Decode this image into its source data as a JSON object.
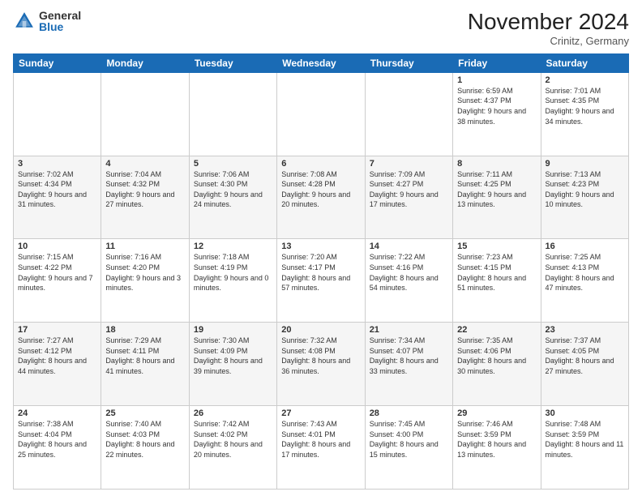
{
  "logo": {
    "general": "General",
    "blue": "Blue"
  },
  "header": {
    "month": "November 2024",
    "location": "Crinitz, Germany"
  },
  "weekdays": [
    "Sunday",
    "Monday",
    "Tuesday",
    "Wednesday",
    "Thursday",
    "Friday",
    "Saturday"
  ],
  "weeks": [
    [
      {
        "day": "",
        "sunrise": "",
        "sunset": "",
        "daylight": ""
      },
      {
        "day": "",
        "sunrise": "",
        "sunset": "",
        "daylight": ""
      },
      {
        "day": "",
        "sunrise": "",
        "sunset": "",
        "daylight": ""
      },
      {
        "day": "",
        "sunrise": "",
        "sunset": "",
        "daylight": ""
      },
      {
        "day": "",
        "sunrise": "",
        "sunset": "",
        "daylight": ""
      },
      {
        "day": "1",
        "sunrise": "Sunrise: 6:59 AM",
        "sunset": "Sunset: 4:37 PM",
        "daylight": "Daylight: 9 hours and 38 minutes."
      },
      {
        "day": "2",
        "sunrise": "Sunrise: 7:01 AM",
        "sunset": "Sunset: 4:35 PM",
        "daylight": "Daylight: 9 hours and 34 minutes."
      }
    ],
    [
      {
        "day": "3",
        "sunrise": "Sunrise: 7:02 AM",
        "sunset": "Sunset: 4:34 PM",
        "daylight": "Daylight: 9 hours and 31 minutes."
      },
      {
        "day": "4",
        "sunrise": "Sunrise: 7:04 AM",
        "sunset": "Sunset: 4:32 PM",
        "daylight": "Daylight: 9 hours and 27 minutes."
      },
      {
        "day": "5",
        "sunrise": "Sunrise: 7:06 AM",
        "sunset": "Sunset: 4:30 PM",
        "daylight": "Daylight: 9 hours and 24 minutes."
      },
      {
        "day": "6",
        "sunrise": "Sunrise: 7:08 AM",
        "sunset": "Sunset: 4:28 PM",
        "daylight": "Daylight: 9 hours and 20 minutes."
      },
      {
        "day": "7",
        "sunrise": "Sunrise: 7:09 AM",
        "sunset": "Sunset: 4:27 PM",
        "daylight": "Daylight: 9 hours and 17 minutes."
      },
      {
        "day": "8",
        "sunrise": "Sunrise: 7:11 AM",
        "sunset": "Sunset: 4:25 PM",
        "daylight": "Daylight: 9 hours and 13 minutes."
      },
      {
        "day": "9",
        "sunrise": "Sunrise: 7:13 AM",
        "sunset": "Sunset: 4:23 PM",
        "daylight": "Daylight: 9 hours and 10 minutes."
      }
    ],
    [
      {
        "day": "10",
        "sunrise": "Sunrise: 7:15 AM",
        "sunset": "Sunset: 4:22 PM",
        "daylight": "Daylight: 9 hours and 7 minutes."
      },
      {
        "day": "11",
        "sunrise": "Sunrise: 7:16 AM",
        "sunset": "Sunset: 4:20 PM",
        "daylight": "Daylight: 9 hours and 3 minutes."
      },
      {
        "day": "12",
        "sunrise": "Sunrise: 7:18 AM",
        "sunset": "Sunset: 4:19 PM",
        "daylight": "Daylight: 9 hours and 0 minutes."
      },
      {
        "day": "13",
        "sunrise": "Sunrise: 7:20 AM",
        "sunset": "Sunset: 4:17 PM",
        "daylight": "Daylight: 8 hours and 57 minutes."
      },
      {
        "day": "14",
        "sunrise": "Sunrise: 7:22 AM",
        "sunset": "Sunset: 4:16 PM",
        "daylight": "Daylight: 8 hours and 54 minutes."
      },
      {
        "day": "15",
        "sunrise": "Sunrise: 7:23 AM",
        "sunset": "Sunset: 4:15 PM",
        "daylight": "Daylight: 8 hours and 51 minutes."
      },
      {
        "day": "16",
        "sunrise": "Sunrise: 7:25 AM",
        "sunset": "Sunset: 4:13 PM",
        "daylight": "Daylight: 8 hours and 47 minutes."
      }
    ],
    [
      {
        "day": "17",
        "sunrise": "Sunrise: 7:27 AM",
        "sunset": "Sunset: 4:12 PM",
        "daylight": "Daylight: 8 hours and 44 minutes."
      },
      {
        "day": "18",
        "sunrise": "Sunrise: 7:29 AM",
        "sunset": "Sunset: 4:11 PM",
        "daylight": "Daylight: 8 hours and 41 minutes."
      },
      {
        "day": "19",
        "sunrise": "Sunrise: 7:30 AM",
        "sunset": "Sunset: 4:09 PM",
        "daylight": "Daylight: 8 hours and 39 minutes."
      },
      {
        "day": "20",
        "sunrise": "Sunrise: 7:32 AM",
        "sunset": "Sunset: 4:08 PM",
        "daylight": "Daylight: 8 hours and 36 minutes."
      },
      {
        "day": "21",
        "sunrise": "Sunrise: 7:34 AM",
        "sunset": "Sunset: 4:07 PM",
        "daylight": "Daylight: 8 hours and 33 minutes."
      },
      {
        "day": "22",
        "sunrise": "Sunrise: 7:35 AM",
        "sunset": "Sunset: 4:06 PM",
        "daylight": "Daylight: 8 hours and 30 minutes."
      },
      {
        "day": "23",
        "sunrise": "Sunrise: 7:37 AM",
        "sunset": "Sunset: 4:05 PM",
        "daylight": "Daylight: 8 hours and 27 minutes."
      }
    ],
    [
      {
        "day": "24",
        "sunrise": "Sunrise: 7:38 AM",
        "sunset": "Sunset: 4:04 PM",
        "daylight": "Daylight: 8 hours and 25 minutes."
      },
      {
        "day": "25",
        "sunrise": "Sunrise: 7:40 AM",
        "sunset": "Sunset: 4:03 PM",
        "daylight": "Daylight: 8 hours and 22 minutes."
      },
      {
        "day": "26",
        "sunrise": "Sunrise: 7:42 AM",
        "sunset": "Sunset: 4:02 PM",
        "daylight": "Daylight: 8 hours and 20 minutes."
      },
      {
        "day": "27",
        "sunrise": "Sunrise: 7:43 AM",
        "sunset": "Sunset: 4:01 PM",
        "daylight": "Daylight: 8 hours and 17 minutes."
      },
      {
        "day": "28",
        "sunrise": "Sunrise: 7:45 AM",
        "sunset": "Sunset: 4:00 PM",
        "daylight": "Daylight: 8 hours and 15 minutes."
      },
      {
        "day": "29",
        "sunrise": "Sunrise: 7:46 AM",
        "sunset": "Sunset: 3:59 PM",
        "daylight": "Daylight: 8 hours and 13 minutes."
      },
      {
        "day": "30",
        "sunrise": "Sunrise: 7:48 AM",
        "sunset": "Sunset: 3:59 PM",
        "daylight": "Daylight: 8 hours and 11 minutes."
      }
    ]
  ]
}
